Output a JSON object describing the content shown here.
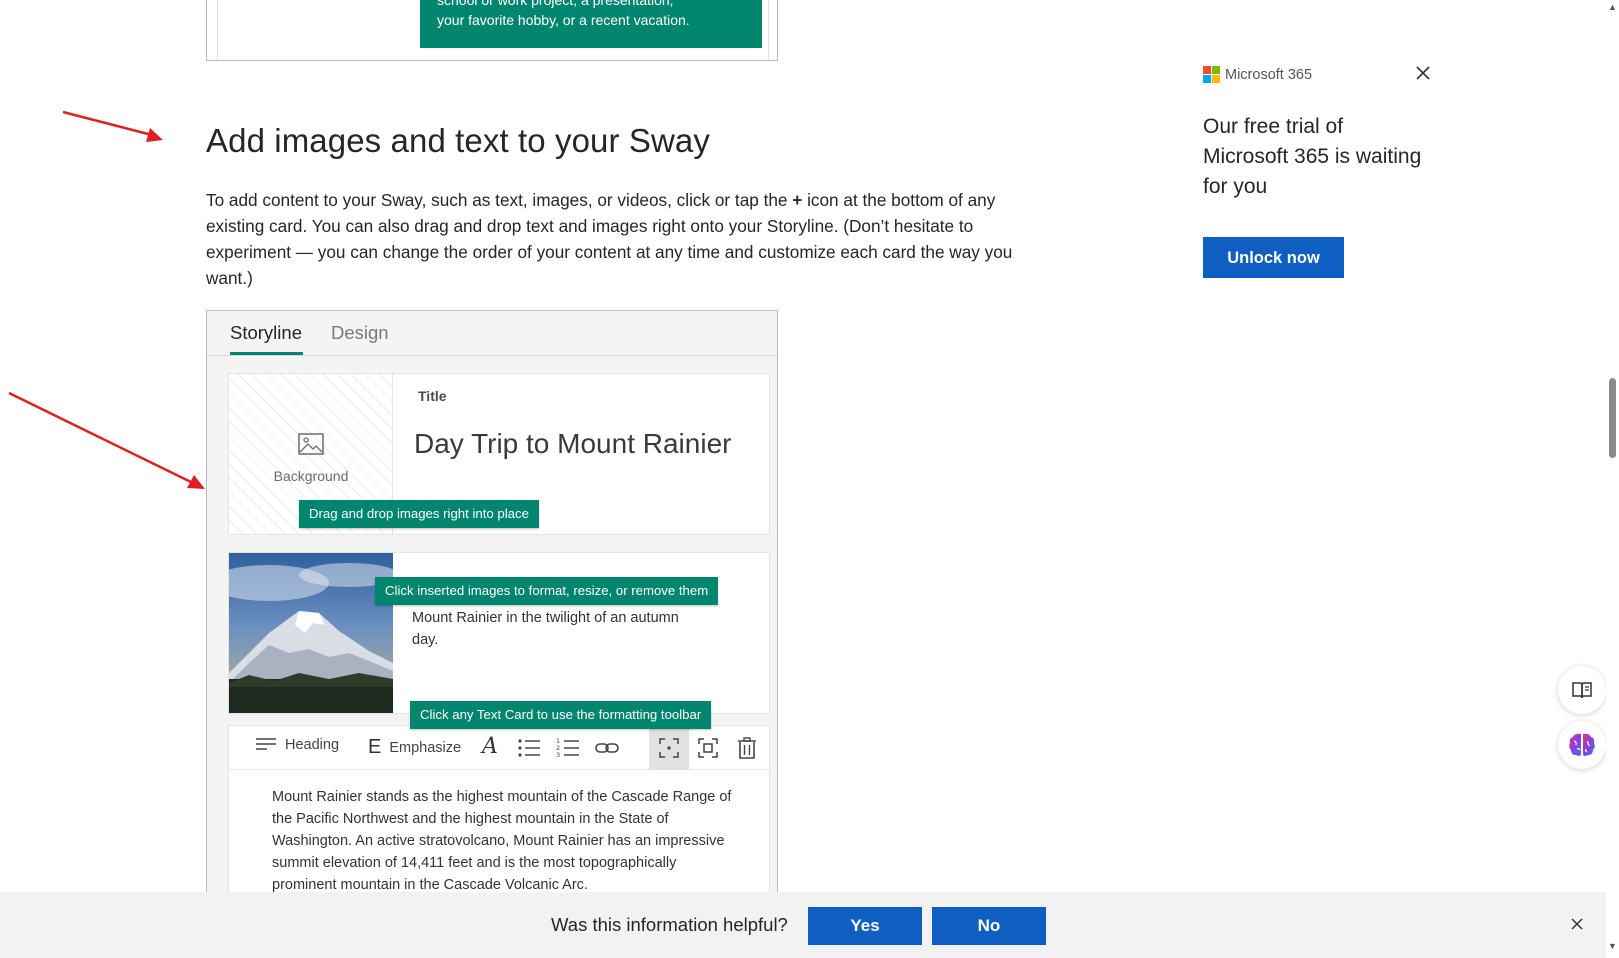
{
  "previous_figure": {
    "lines": [
      "school or work project, a presentation,",
      "your favorite hobby, or a recent vacation."
    ]
  },
  "article": {
    "heading": "Add images and text to your Sway",
    "paragraph_before": "To add content to your Sway, such as text, images, or videos, click or tap the ",
    "paragraph_bold": "+",
    "paragraph_after": " icon at the bottom of any existing card. You can also drag and drop text and images right onto your Storyline. (Don’t hesitate to experiment — you can change the order of your content at any time and customize each card the way you want.)"
  },
  "figure": {
    "tabs": [
      "Storyline",
      "Design"
    ],
    "title_card": {
      "background_label": "Background",
      "title_label": "Title",
      "title_text": "Day Trip to Mount Rainier",
      "tip": "Drag and drop images right into place"
    },
    "image_card": {
      "tip": "Click inserted images to format, resize, or remove them",
      "caption": "Mount Rainier in the twilight of an autumn day."
    },
    "text_card": {
      "tip": "Click any Text Card to use the formatting toolbar",
      "toolbar": {
        "heading_label": "Heading",
        "emphasize_label": "Emphasize"
      },
      "body": "Mount Rainier stands as the highest mountain of the Cascade Range of the Pacific Northwest and the highest mountain in the State of Washington. An active stratovolcano, Mount Rainier has an impressive summit elevation of 14,411 feet and is the most topographically prominent mountain in the Cascade Volcanic Arc."
    }
  },
  "ad": {
    "brand": "Microsoft 365",
    "text": "Our free trial of Microsoft 365 is waiting for you",
    "button": "Unlock now"
  },
  "feedback": {
    "question": "Was this information helpful?",
    "yes": "Yes",
    "no": "No"
  },
  "colors": {
    "accent_green": "#00856f",
    "button_blue": "#0f5fc2",
    "annotation_red": "#e02020"
  }
}
